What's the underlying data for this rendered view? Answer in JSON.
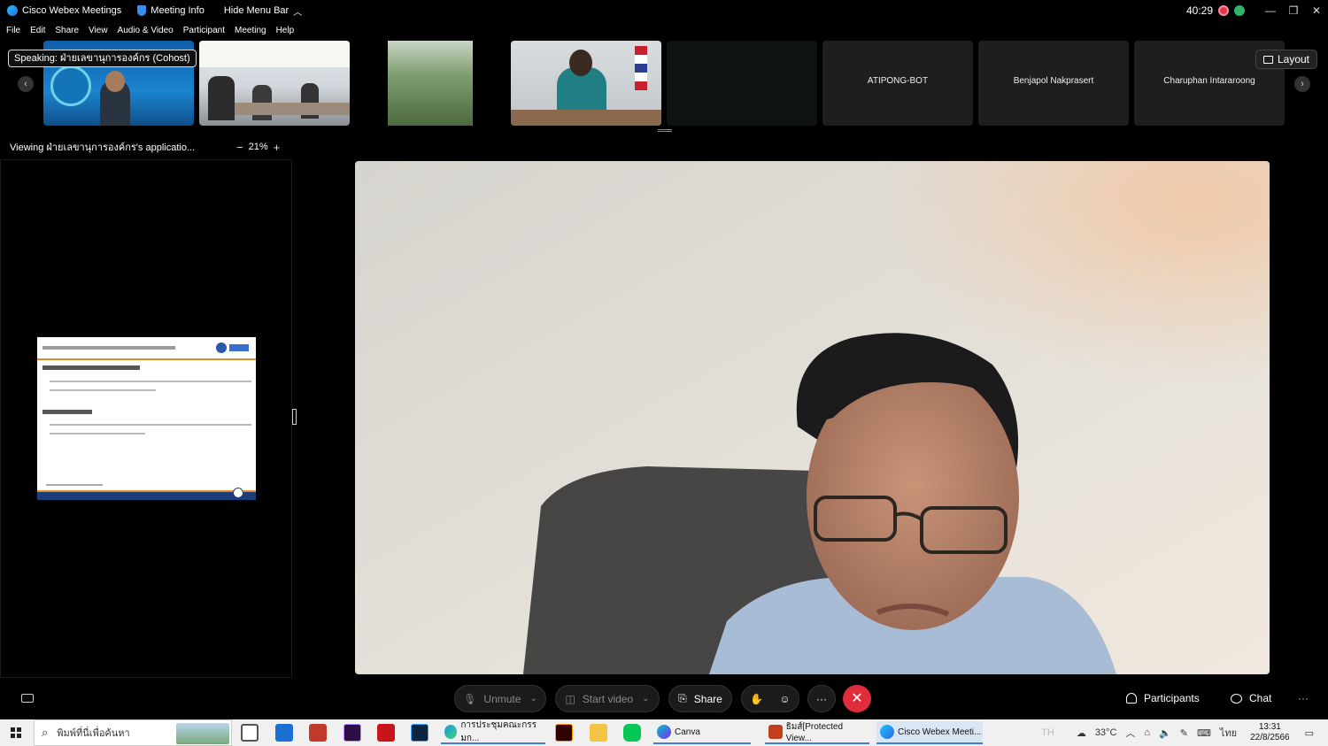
{
  "titlebar": {
    "app_name": "Cisco Webex Meetings",
    "meeting_info": "Meeting Info",
    "hide_menu": "Hide Menu Bar",
    "timer": "40:29",
    "minimize": "—",
    "restore": "❐",
    "close": "✕"
  },
  "menu": [
    "File",
    "Edit",
    "Share",
    "View",
    "Audio & Video",
    "Participant",
    "Meeting",
    "Help"
  ],
  "filmstrip": {
    "speaking": "Speaking: ฝ่ายเลขานุการองค์กร (Cohost)",
    "layout": "Layout",
    "prev": "‹",
    "next": "›",
    "names": [
      "ATIPONG-BOT",
      "Benjapol Nakprasert",
      "Charuphan Intararoong"
    ]
  },
  "share": {
    "viewing": "Viewing ฝ่ายเลขานุการองค์กร's applicatio...",
    "zoom_minus": "−",
    "zoom_plus": "+",
    "zoom_level": "21%"
  },
  "controls": {
    "unmute": "Unmute",
    "start_video": "Start video",
    "share": "Share",
    "more": "···",
    "end": "✕",
    "participants": "Participants",
    "chat": "Chat",
    "overflow": "···"
  },
  "taskbar": {
    "search_placeholder": "พิมพ์ที่นี่เพื่อค้นหา",
    "win_edge": "การประชุมคณะกรรมก...",
    "win_canva": "Canva",
    "win_ppt": "ธิมส์[Protected View...",
    "win_webex": "Cisco Webex Meeti...",
    "lang": "TH",
    "temp": "33°C",
    "input_lang": "ไทย",
    "time": "13:31",
    "date": "22/8/2566"
  },
  "colors": {
    "end_call": "#e02d3c",
    "record": "#e8344a",
    "slide_footer": "#1d3d7a",
    "slide_accent": "#e48b2a"
  }
}
